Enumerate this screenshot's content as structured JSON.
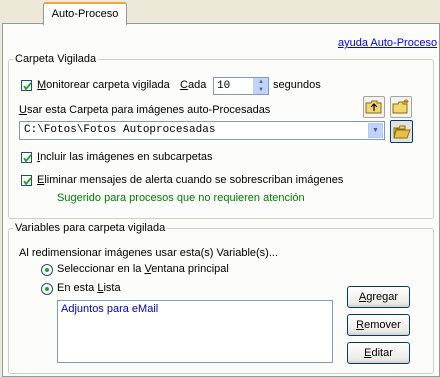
{
  "tabs": [
    {
      "label": "Auto-Proceso",
      "active": true
    }
  ],
  "help_link": "ayuda Auto-Proceso",
  "watched_folder": {
    "title": "Carpeta Vigilada",
    "monitor_label_prefix": "M",
    "monitor_label_rest": "onitorear carpeta vigilada",
    "monitor_checked": true,
    "every_label_prefix": "C",
    "every_label_rest": "ada",
    "every_value": "10",
    "seconds_label": "segundos",
    "use_folder_label_prefix": "U",
    "use_folder_label_rest": "sar esta Carpeta para imágenes auto-Procesadas",
    "folder_path": "C:\\Fotos\\Fotos Autoprocesadas",
    "include_sub_prefix": "I",
    "include_sub_rest": "ncluir las imágenes en subcarpetas",
    "include_sub_checked": true,
    "suppress_prefix": "E",
    "suppress_rest": "liminar mensajes de alerta cuando se sobrescriban imágenes",
    "suppress_checked": true,
    "suggestion": "Sugerido para procesos que no requieren atención",
    "icons": [
      "folder-up-icon",
      "new-folder-icon",
      "open-folder-icon"
    ]
  },
  "variables": {
    "title": "Variables para carpeta vigilada",
    "intro": "Al redimensionar imágenes usar esta(s) Variable(s)...",
    "radio_main_pre": "Seleccionar en la ",
    "radio_main_key": "V",
    "radio_main_post": "entana principal",
    "radio_list_pre": "En esta ",
    "radio_list_key": "L",
    "radio_list_post": "ista",
    "selected_option": "list",
    "list_items": [
      "Adjuntos para eMail"
    ],
    "add_pre": "",
    "add_key": "A",
    "add_post": "gregar",
    "remove_pre": "",
    "remove_key": "R",
    "remove_post": "emover",
    "edit_pre": "",
    "edit_key": "E",
    "edit_post": "ditar"
  },
  "colors": {
    "link": "#0000ff",
    "suggestion": "#008000",
    "list_text": "#0000cc",
    "tab_accent": "#f3a33a"
  }
}
